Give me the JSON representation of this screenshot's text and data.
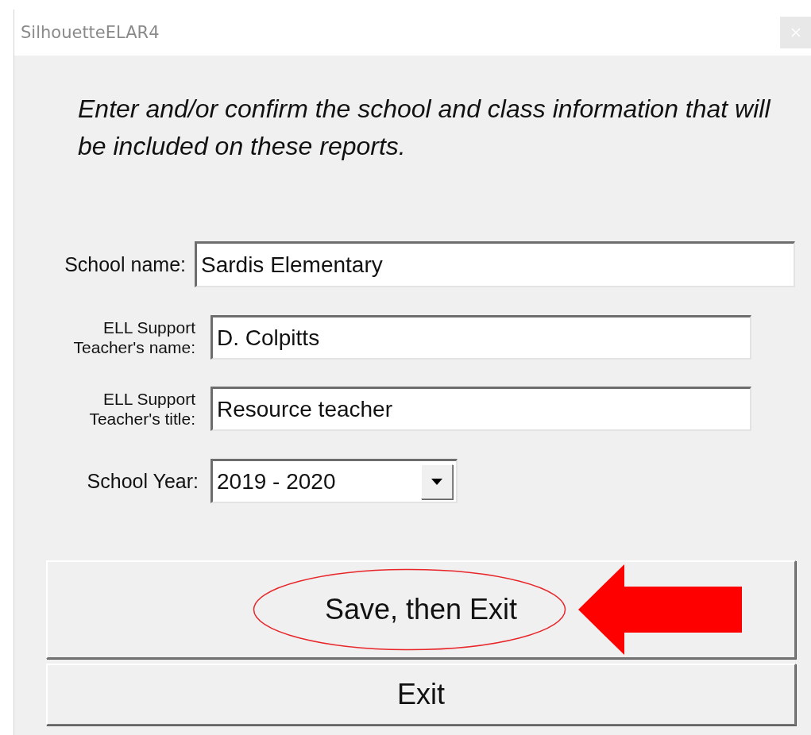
{
  "window": {
    "title": "SilhouetteELAR4"
  },
  "instructions": "Enter and/or confirm the school and class information that will be included on these reports.",
  "fields": [
    {
      "kind": "wide_text",
      "label": "School name:",
      "value": "Sardis Elementary"
    },
    {
      "kind": "text",
      "label": "ELL Support Teacher's name:",
      "value": "D. Colpitts"
    },
    {
      "kind": "text",
      "label": "ELL Support Teacher's title:",
      "value": "Resource teacher"
    },
    {
      "kind": "dropdown",
      "label": "School Year:",
      "value": "2019 - 2020"
    }
  ],
  "buttons": [
    {
      "label": "Save, then Exit",
      "highlighted": true
    },
    {
      "label": "Exit",
      "highlighted": false
    }
  ]
}
